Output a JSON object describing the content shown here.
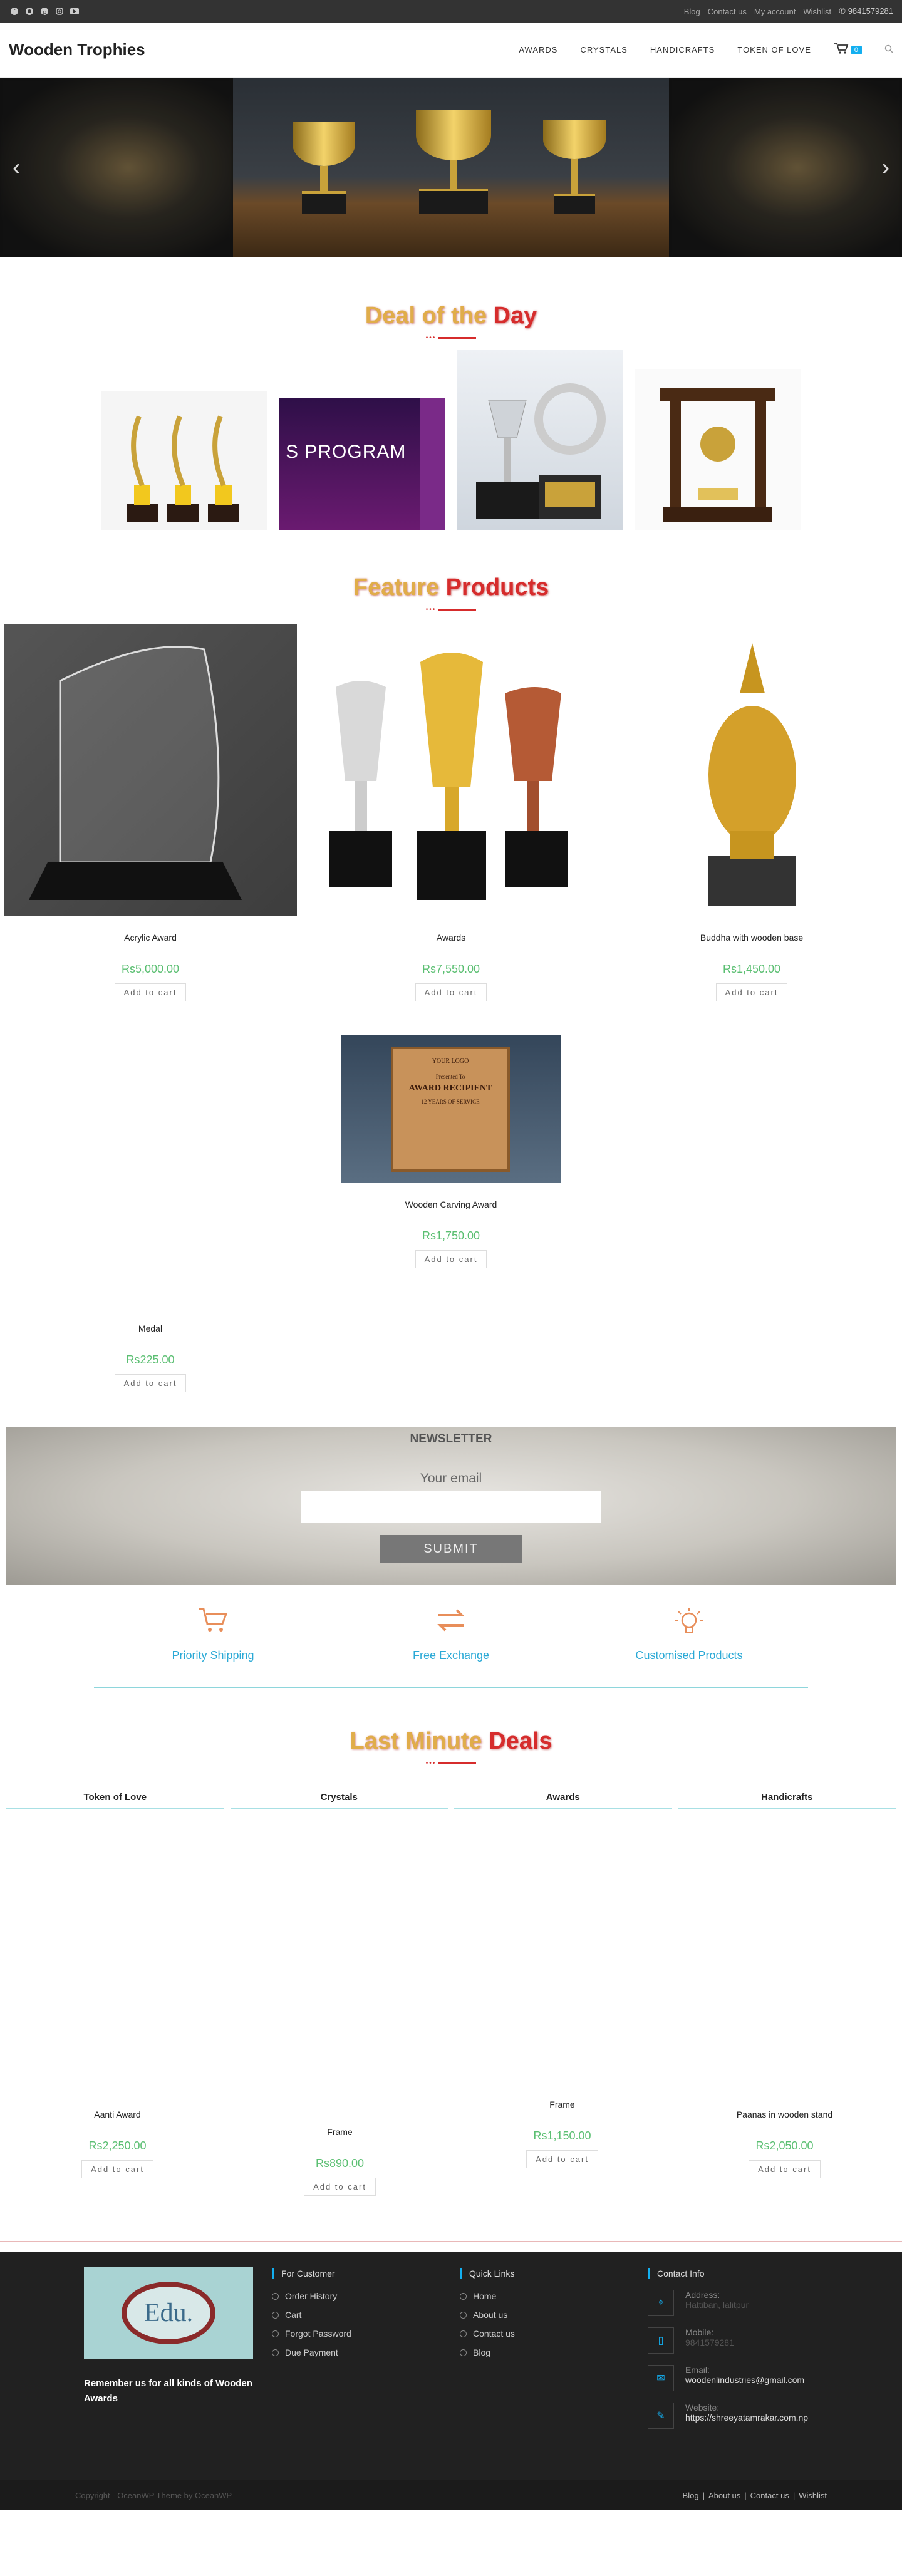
{
  "topbar": {
    "social": [
      "facebook-icon",
      "github-icon",
      "pinterest-icon",
      "instagram-icon",
      "youtube-icon"
    ],
    "links": [
      "Blog",
      "Contact us",
      "My account",
      "Wishlist"
    ],
    "phone": "9841579281"
  },
  "header": {
    "logo": "Wooden Trophies",
    "nav": [
      "AWARDS",
      "CRYSTALS",
      "HANDICRAFTS",
      "TOKEN OF LOVE"
    ],
    "cart_count": "0"
  },
  "deal": {
    "title_a": "Deal of the ",
    "title_b": "Day"
  },
  "feature": {
    "title_a": "Feature ",
    "title_b": "Products"
  },
  "products": [
    {
      "name": "Acrylic Award",
      "price": "Rs5,000.00",
      "cta": "Add to cart"
    },
    {
      "name": "Awards",
      "price": "Rs7,550.00",
      "cta": "Add to cart"
    },
    {
      "name": "Buddha with wooden base",
      "price": "Rs1,450.00",
      "cta": "Add to cart"
    },
    {
      "name": "Wooden Carving Award",
      "price": "Rs1,750.00",
      "cta": "Add to cart"
    },
    {
      "name": "Medal",
      "price": "Rs225.00",
      "cta": "Add to cart"
    }
  ],
  "wood_plaque": {
    "l1": "YOUR LOGO",
    "l2": "Presented To",
    "l3": "AWARD RECIPIENT",
    "l4": "12 YEARS OF SERVICE"
  },
  "program_banner": "S PROGRAM",
  "newsletter": {
    "title": "NEWSLETTER",
    "placeholder": "Your email",
    "button": "SUBMIT"
  },
  "services": [
    {
      "icon": "cart-icon",
      "label": "Priority Shipping"
    },
    {
      "icon": "exchange-icon",
      "label": "Free Exchange"
    },
    {
      "icon": "lightbulb-icon",
      "label": "Customised Products"
    }
  ],
  "last": {
    "title_a": "Last Minute ",
    "title_b": "Deals"
  },
  "tabs": [
    "Token of Love",
    "Crystals",
    "Awards",
    "Handicrafts"
  ],
  "last_products": [
    {
      "name": "Aanti Award",
      "price": "Rs2,250.00",
      "cta": "Add to cart"
    },
    {
      "name": "Frame",
      "price": "Rs890.00",
      "cta": "Add to cart"
    },
    {
      "name": "Frame",
      "price": "Rs1,150.00",
      "cta": "Add to cart"
    },
    {
      "name": "Paanas in wooden stand",
      "price": "Rs2,050.00",
      "cta": "Add to cart"
    }
  ],
  "footer": {
    "logo_text": "Edu.",
    "tagline": "Remember us for all kinds of Wooden Awards",
    "customer_title": "For Customer",
    "customer_links": [
      "Order History",
      "Cart",
      "Forgot Password",
      "Due Payment"
    ],
    "quick_title": "Quick Links",
    "quick_links": [
      "Home",
      "About us",
      "Contact us",
      "Blog"
    ],
    "contact_title": "Contact Info",
    "contact": [
      {
        "icon": "map-pin-icon",
        "label": "Address:",
        "value": "Hattiban, lalitpur"
      },
      {
        "icon": "mobile-icon",
        "label": "Mobile:",
        "value": "9841579281"
      },
      {
        "icon": "mail-icon",
        "label": "Email:",
        "value": "woodenlindustries@gmail.com"
      },
      {
        "icon": "pencil-icon",
        "label": "Website:",
        "value": "https://shreeyatamrakar.com.np"
      }
    ],
    "copyright": "Copyright - OceanWP Theme by OceanWP",
    "bottom_links": [
      "Blog",
      "About us",
      "Contact us",
      "Wishlist"
    ]
  }
}
